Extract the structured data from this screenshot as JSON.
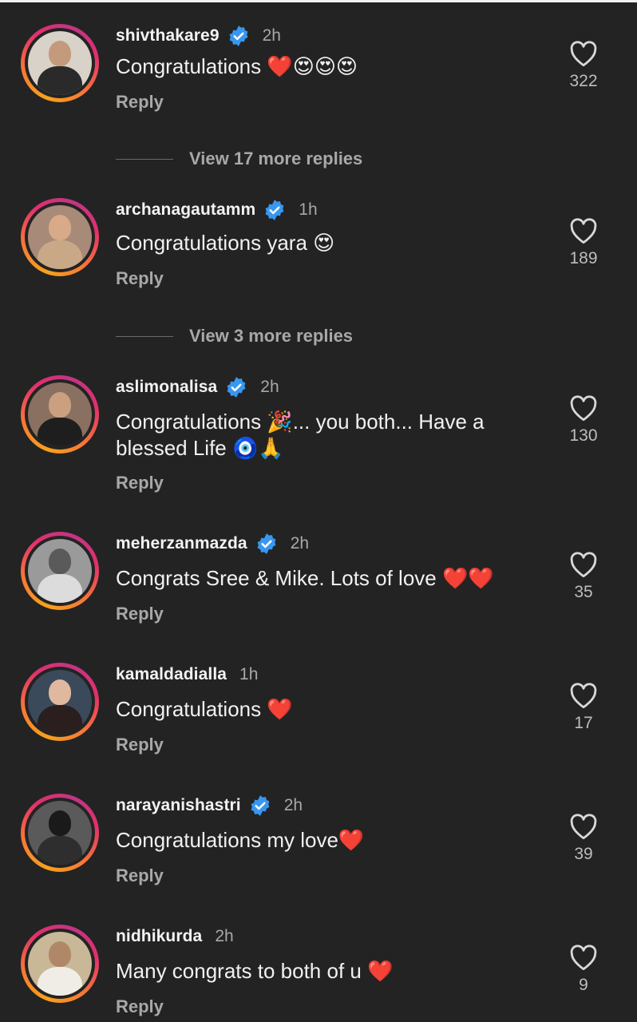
{
  "comments": [
    {
      "username": "shivthakare9",
      "verified": true,
      "time": "2h",
      "text": "Congratulations ❤️😍😍😍",
      "reply_label": "Reply",
      "likes": "322",
      "view_more": "View 17 more replies"
    },
    {
      "username": "archanagautamm",
      "verified": true,
      "time": "1h",
      "text": "Congratulations yara 😍",
      "reply_label": "Reply",
      "likes": "189",
      "view_more": "View 3 more replies"
    },
    {
      "username": "aslimonalisa",
      "verified": true,
      "time": "2h",
      "text": "Congratulations 🎉... you both... Have a blessed Life 🧿🙏",
      "reply_label": "Reply",
      "likes": "130"
    },
    {
      "username": "meherzanmazda",
      "verified": true,
      "time": "2h",
      "text": "Congrats Sree & Mike. Lots of love ❤️❤️",
      "reply_label": "Reply",
      "likes": "35"
    },
    {
      "username": "kamaldadialla",
      "verified": false,
      "time": "1h",
      "text": "Congratulations ❤️",
      "reply_label": "Reply",
      "likes": "17"
    },
    {
      "username": "narayanishastri",
      "verified": true,
      "time": "2h",
      "text": "Congratulations my love❤️",
      "reply_label": "Reply",
      "likes": "39"
    },
    {
      "username": "nidhikurda",
      "verified": false,
      "time": "2h",
      "text": "Many congrats to both of u ❤️",
      "reply_label": "Reply",
      "likes": "9"
    }
  ],
  "colors": {
    "background": "#232323",
    "verified_badge": "#3897f0",
    "secondary_text": "#a8a8a8"
  },
  "icons": {
    "verified": "verified-badge-icon",
    "like": "heart-outline-icon"
  }
}
